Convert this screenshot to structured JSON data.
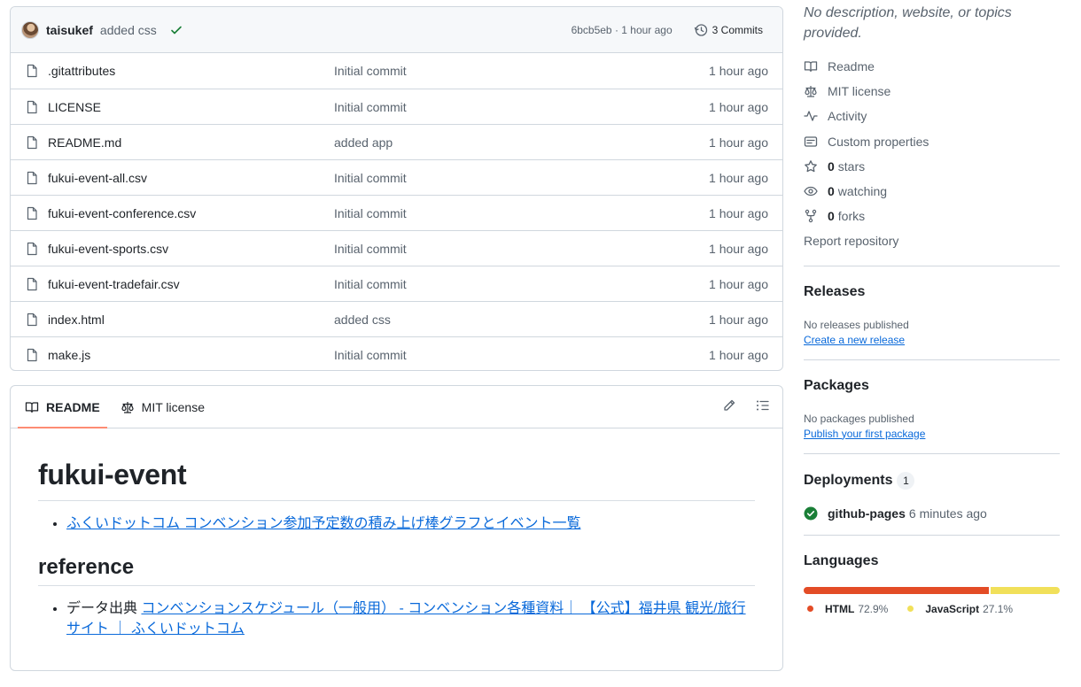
{
  "latest_commit": {
    "author": "taisukef",
    "message": "added css",
    "hash_time": "6bcb5eb · 1 hour ago",
    "commits_label": "3 Commits"
  },
  "files": [
    {
      "name": ".gitattributes",
      "message": "Initial commit",
      "time": "1 hour ago"
    },
    {
      "name": "LICENSE",
      "message": "Initial commit",
      "time": "1 hour ago"
    },
    {
      "name": "README.md",
      "message": "added app",
      "time": "1 hour ago"
    },
    {
      "name": "fukui-event-all.csv",
      "message": "Initial commit",
      "time": "1 hour ago"
    },
    {
      "name": "fukui-event-conference.csv",
      "message": "Initial commit",
      "time": "1 hour ago"
    },
    {
      "name": "fukui-event-sports.csv",
      "message": "Initial commit",
      "time": "1 hour ago"
    },
    {
      "name": "fukui-event-tradefair.csv",
      "message": "Initial commit",
      "time": "1 hour ago"
    },
    {
      "name": "index.html",
      "message": "added css",
      "time": "1 hour ago"
    },
    {
      "name": "make.js",
      "message": "Initial commit",
      "time": "1 hour ago"
    }
  ],
  "readme": {
    "tabs": [
      "README",
      "MIT license"
    ],
    "title": "fukui-event",
    "link1": "ふくいドットコム コンベンション参加予定数の積み上げ棒グラフとイベント一覧",
    "heading2": "reference",
    "ref_prefix": "データ出典 ",
    "ref_link": "コンベンションスケジュール（一般用） - コンベンション各種資料｜ 【公式】福井県 観光/旅行サイト ｜ ふくいドットコム"
  },
  "sidebar": {
    "description": "No description, website, or topics provided.",
    "about": [
      {
        "icon": "book-icon",
        "label": "Readme"
      },
      {
        "icon": "law-icon",
        "label": "MIT license"
      },
      {
        "icon": "pulse-icon",
        "label": "Activity"
      },
      {
        "icon": "note-icon",
        "label": "Custom properties"
      }
    ],
    "stars_count": "0",
    "stars_label": "stars",
    "watching_count": "0",
    "watching_label": "watching",
    "forks_count": "0",
    "forks_label": "forks",
    "report": "Report repository",
    "releases_title": "Releases",
    "releases_none": "No releases published",
    "releases_link": "Create a new release",
    "packages_title": "Packages",
    "packages_none": "No packages published",
    "packages_link": "Publish your first package",
    "deployments_title": "Deployments",
    "deployments_count": "1",
    "deploy_name": "github-pages",
    "deploy_time": "6 minutes ago",
    "languages_title": "Languages",
    "languages": [
      {
        "name": "HTML",
        "pct": "72.9%",
        "value": 72.9,
        "color": "#e34c26"
      },
      {
        "name": "JavaScript",
        "pct": "27.1%",
        "value": 27.1,
        "color": "#f1e05a"
      }
    ]
  }
}
